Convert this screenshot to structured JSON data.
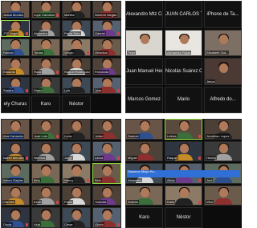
{
  "colors": {
    "window_bg": "#0c0c0c",
    "tile_bg": "#1b1b1b",
    "active_speaker_border": "#8fdc3c",
    "muted_mic": "#d24545",
    "chat_banner": "#2f6fd6"
  },
  "quadrants": {
    "top_left": {
      "names": [
        "Juana Montes",
        "Lupe Carcamo",
        "Martha",
        "Nohemi Vargas",
        "JTC Angel",
        "Alejandra",
        "Paola Soto",
        "Gabriel",
        "Ramon",
        "Tomas",
        "Sergio",
        "Veronica",
        "Eduardo",
        "Rosa",
        "Raquel Rodriguez",
        "Fernanda",
        "Sandra",
        "Diana",
        "Luis",
        "Jose"
      ],
      "bottom_names": [
        "ely Churas",
        "Karo",
        "Néstor"
      ]
    },
    "top_right": {
      "header_names": [
        "Alexandro Mtz Caball...",
        "JUAN CARLOS TOR...",
        "iPhone de Ta..."
      ],
      "video_names": [
        "Pepe",
        "Alexandro Rojas",
        "Elizabeth Gut..."
      ],
      "row3_names": [
        "Juan Manuel Herrera",
        "Nicolás Suárez Cont...",
        "Jesus"
      ],
      "bottom_names": [
        "Marcos Gomez",
        "Mario",
        "Alfredo do..."
      ]
    },
    "bottom_left": {
      "names": [
        "Ana Camacho",
        "Jose Luis",
        "Lucia",
        "Julian",
        "Isabel Mendez",
        "Nereida",
        "Jorge",
        "Laura",
        "Arturo Gaytan",
        "Bety",
        "Nancy",
        "Beto",
        "Carmen",
        "Irene",
        "Pablo",
        "Yolanda",
        "Oscar",
        "Aida",
        "Cesar",
        "Gloria"
      ]
    },
    "bottom_right": {
      "names": [
        "Samuel",
        "Leticia",
        "Jonathan Lopez",
        "Miguel",
        "Raquel",
        "Hector",
        "Alejandra",
        "Alicia",
        "Joel",
        "Andrea",
        "Karla",
        "Vero"
      ],
      "chat_banner": "Salomon Mayo Ro...",
      "bottom_names": [
        "Karo",
        "Néstor"
      ]
    }
  }
}
